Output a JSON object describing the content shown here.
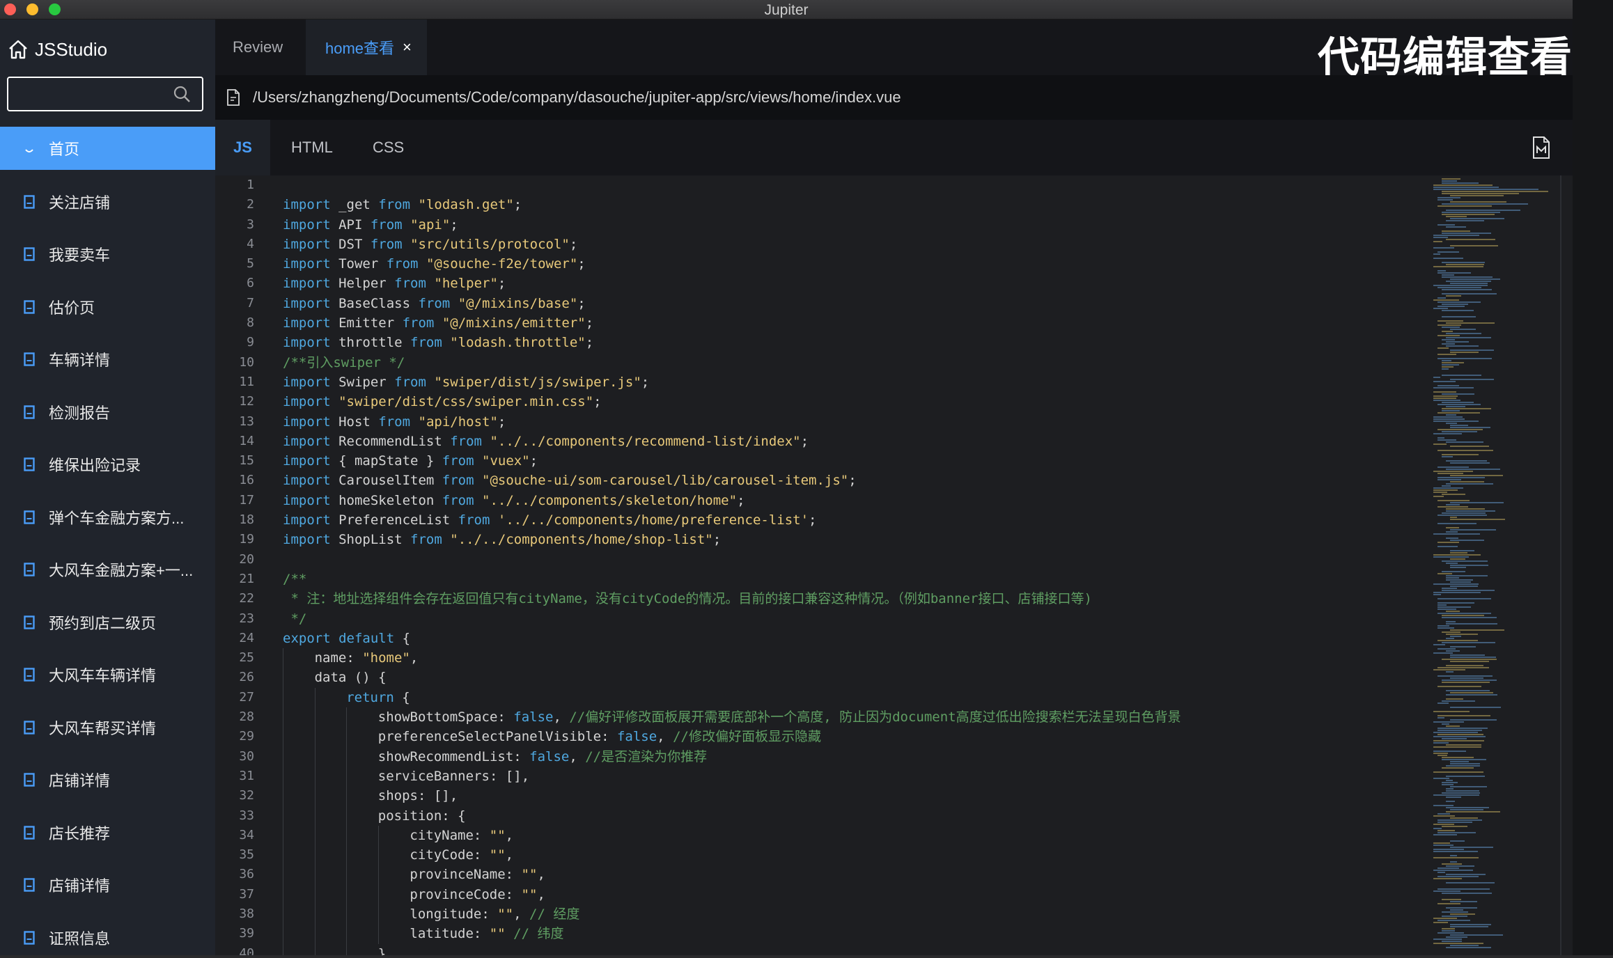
{
  "window": {
    "title": "Jupiter"
  },
  "overlay": {
    "caption": "代码编辑查看"
  },
  "sidebar": {
    "brand": "JSStudio",
    "search": {
      "value": "",
      "placeholder": ""
    },
    "items": [
      {
        "label": "首页",
        "active": true
      },
      {
        "label": "关注店铺"
      },
      {
        "label": "我要卖车"
      },
      {
        "label": "估价页"
      },
      {
        "label": "车辆详情"
      },
      {
        "label": "检测报告"
      },
      {
        "label": "维保出险记录"
      },
      {
        "label": "弹个车金融方案方..."
      },
      {
        "label": "大风车金融方案+一..."
      },
      {
        "label": "预约到店二级页"
      },
      {
        "label": "大风车车辆详情"
      },
      {
        "label": "大风车帮买详情"
      },
      {
        "label": "店铺详情"
      },
      {
        "label": "店长推荐"
      },
      {
        "label": "店铺详情"
      },
      {
        "label": "证照信息"
      }
    ]
  },
  "tabs": [
    {
      "label": "Review"
    },
    {
      "label": "home查看",
      "active": true,
      "close": "×"
    }
  ],
  "file": {
    "path": "/Users/zhangzheng/Documents/Code/company/dasouche/jupiter-app/src/views/home/index.vue"
  },
  "code_tabs": [
    {
      "label": "JS",
      "active": true
    },
    {
      "label": "HTML"
    },
    {
      "label": "CSS"
    }
  ],
  "colors": {
    "accent": "#4a9df8",
    "sidebar_bg": "#20242c",
    "editor_bg": "#1d1e21",
    "keyword": "#4fa8e0",
    "string": "#e8c97a",
    "comment": "#5f9e62"
  },
  "code": {
    "lines": [
      {
        "n": "1",
        "indent": 0,
        "tokens": []
      },
      {
        "n": "2",
        "indent": 0,
        "tokens": [
          [
            "kw",
            "import"
          ],
          [
            "id",
            " _get "
          ],
          [
            "kw",
            "from"
          ],
          [
            "id",
            " "
          ],
          [
            "str",
            "\"lodash.get\""
          ],
          [
            "id",
            ";"
          ]
        ]
      },
      {
        "n": "3",
        "indent": 0,
        "tokens": [
          [
            "kw",
            "import"
          ],
          [
            "id",
            " API "
          ],
          [
            "kw",
            "from"
          ],
          [
            "id",
            " "
          ],
          [
            "str",
            "\"api\""
          ],
          [
            "id",
            ";"
          ]
        ]
      },
      {
        "n": "4",
        "indent": 0,
        "tokens": [
          [
            "kw",
            "import"
          ],
          [
            "id",
            " DST "
          ],
          [
            "kw",
            "from"
          ],
          [
            "id",
            " "
          ],
          [
            "str",
            "\"src/utils/protocol\""
          ],
          [
            "id",
            ";"
          ]
        ]
      },
      {
        "n": "5",
        "indent": 0,
        "tokens": [
          [
            "kw",
            "import"
          ],
          [
            "id",
            " Tower "
          ],
          [
            "kw",
            "from"
          ],
          [
            "id",
            " "
          ],
          [
            "str",
            "\"@souche-f2e/tower\""
          ],
          [
            "id",
            ";"
          ]
        ]
      },
      {
        "n": "6",
        "indent": 0,
        "tokens": [
          [
            "kw",
            "import"
          ],
          [
            "id",
            " Helper "
          ],
          [
            "kw",
            "from"
          ],
          [
            "id",
            " "
          ],
          [
            "str",
            "\"helper\""
          ],
          [
            "id",
            ";"
          ]
        ]
      },
      {
        "n": "7",
        "indent": 0,
        "tokens": [
          [
            "kw",
            "import"
          ],
          [
            "id",
            " BaseClass "
          ],
          [
            "kw",
            "from"
          ],
          [
            "id",
            " "
          ],
          [
            "str",
            "\"@/mixins/base\""
          ],
          [
            "id",
            ";"
          ]
        ]
      },
      {
        "n": "8",
        "indent": 0,
        "tokens": [
          [
            "kw",
            "import"
          ],
          [
            "id",
            " Emitter "
          ],
          [
            "kw",
            "from"
          ],
          [
            "id",
            " "
          ],
          [
            "str",
            "\"@/mixins/emitter\""
          ],
          [
            "id",
            ";"
          ]
        ]
      },
      {
        "n": "9",
        "indent": 0,
        "tokens": [
          [
            "kw",
            "import"
          ],
          [
            "id",
            " throttle "
          ],
          [
            "kw",
            "from"
          ],
          [
            "id",
            " "
          ],
          [
            "str",
            "\"lodash.throttle\""
          ],
          [
            "id",
            ";"
          ]
        ]
      },
      {
        "n": "10",
        "indent": 0,
        "tokens": [
          [
            "cm",
            "/**引入swiper */"
          ]
        ]
      },
      {
        "n": "11",
        "indent": 0,
        "tokens": [
          [
            "kw",
            "import"
          ],
          [
            "id",
            " Swiper "
          ],
          [
            "kw",
            "from"
          ],
          [
            "id",
            " "
          ],
          [
            "str",
            "\"swiper/dist/js/swiper.js\""
          ],
          [
            "id",
            ";"
          ]
        ]
      },
      {
        "n": "12",
        "indent": 0,
        "tokens": [
          [
            "kw",
            "import"
          ],
          [
            "id",
            " "
          ],
          [
            "str",
            "\"swiper/dist/css/swiper.min.css\""
          ],
          [
            "id",
            ";"
          ]
        ]
      },
      {
        "n": "13",
        "indent": 0,
        "tokens": [
          [
            "kw",
            "import"
          ],
          [
            "id",
            " Host "
          ],
          [
            "kw",
            "from"
          ],
          [
            "id",
            " "
          ],
          [
            "str",
            "\"api/host\""
          ],
          [
            "id",
            ";"
          ]
        ]
      },
      {
        "n": "14",
        "indent": 0,
        "tokens": [
          [
            "kw",
            "import"
          ],
          [
            "id",
            " RecommendList "
          ],
          [
            "kw",
            "from"
          ],
          [
            "id",
            " "
          ],
          [
            "str",
            "\"../../components/recommend-list/index\""
          ],
          [
            "id",
            ";"
          ]
        ]
      },
      {
        "n": "15",
        "indent": 0,
        "tokens": [
          [
            "kw",
            "import"
          ],
          [
            "id",
            " { mapState } "
          ],
          [
            "kw",
            "from"
          ],
          [
            "id",
            " "
          ],
          [
            "str",
            "\"vuex\""
          ],
          [
            "id",
            ";"
          ]
        ]
      },
      {
        "n": "16",
        "indent": 0,
        "tokens": [
          [
            "kw",
            "import"
          ],
          [
            "id",
            " CarouselItem "
          ],
          [
            "kw",
            "from"
          ],
          [
            "id",
            " "
          ],
          [
            "str",
            "\"@souche-ui/som-carousel/lib/carousel-item.js\""
          ],
          [
            "id",
            ";"
          ]
        ]
      },
      {
        "n": "17",
        "indent": 0,
        "tokens": [
          [
            "kw",
            "import"
          ],
          [
            "id",
            " homeSkeleton "
          ],
          [
            "kw",
            "from"
          ],
          [
            "id",
            " "
          ],
          [
            "str",
            "\"../../components/skeleton/home\""
          ],
          [
            "id",
            ";"
          ]
        ]
      },
      {
        "n": "18",
        "indent": 0,
        "tokens": [
          [
            "kw",
            "import"
          ],
          [
            "id",
            " PreferenceList "
          ],
          [
            "kw",
            "from"
          ],
          [
            "id",
            " "
          ],
          [
            "str",
            "'../../components/home/preference-list'"
          ],
          [
            "id",
            ";"
          ]
        ]
      },
      {
        "n": "19",
        "indent": 0,
        "tokens": [
          [
            "kw",
            "import"
          ],
          [
            "id",
            " ShopList "
          ],
          [
            "kw",
            "from"
          ],
          [
            "id",
            " "
          ],
          [
            "str",
            "\"../../components/home/shop-list\""
          ],
          [
            "id",
            ";"
          ]
        ]
      },
      {
        "n": "20",
        "indent": 0,
        "tokens": []
      },
      {
        "n": "21",
        "indent": 0,
        "tokens": [
          [
            "cm",
            "/**"
          ]
        ]
      },
      {
        "n": "22",
        "indent": 0,
        "tokens": [
          [
            "cm",
            " * 注：地址选择组件会存在返回值只有cityName，没有cityCode的情况。目前的接口兼容这种情况。（例如banner接口、店铺接口等)"
          ]
        ]
      },
      {
        "n": "23",
        "indent": 0,
        "tokens": [
          [
            "cm",
            " */"
          ]
        ]
      },
      {
        "n": "24",
        "indent": 0,
        "tokens": [
          [
            "kw",
            "export default"
          ],
          [
            "id",
            " {"
          ]
        ]
      },
      {
        "n": "25",
        "indent": 1,
        "tokens": [
          [
            "id",
            "name: "
          ],
          [
            "str",
            "\"home\""
          ],
          [
            "id",
            ","
          ]
        ]
      },
      {
        "n": "26",
        "indent": 1,
        "tokens": [
          [
            "id",
            "data () {"
          ]
        ]
      },
      {
        "n": "27",
        "indent": 2,
        "tokens": [
          [
            "kw",
            "return"
          ],
          [
            "id",
            " {"
          ]
        ]
      },
      {
        "n": "28",
        "indent": 3,
        "tokens": [
          [
            "id",
            "showBottomSpace: "
          ],
          [
            "kw",
            "false"
          ],
          [
            "id",
            ", "
          ],
          [
            "cm",
            "//偏好评修改面板展开需要底部补一个高度, 防止因为document高度过低出险搜索栏无法呈现白色背景"
          ]
        ]
      },
      {
        "n": "29",
        "indent": 3,
        "tokens": [
          [
            "id",
            "preferenceSelectPanelVisible: "
          ],
          [
            "kw",
            "false"
          ],
          [
            "id",
            ", "
          ],
          [
            "cm",
            "//修改偏好面板显示隐藏"
          ]
        ]
      },
      {
        "n": "30",
        "indent": 3,
        "tokens": [
          [
            "id",
            "showRecommendList: "
          ],
          [
            "kw",
            "false"
          ],
          [
            "id",
            ", "
          ],
          [
            "cm",
            "//是否渲染为你推荐"
          ]
        ]
      },
      {
        "n": "31",
        "indent": 3,
        "tokens": [
          [
            "id",
            "serviceBanners: [],"
          ]
        ]
      },
      {
        "n": "32",
        "indent": 3,
        "tokens": [
          [
            "id",
            "shops: [],"
          ]
        ]
      },
      {
        "n": "33",
        "indent": 3,
        "tokens": [
          [
            "id",
            "position: {"
          ]
        ]
      },
      {
        "n": "34",
        "indent": 4,
        "tokens": [
          [
            "id",
            "cityName: "
          ],
          [
            "str",
            "\"\""
          ],
          [
            "id",
            ","
          ]
        ]
      },
      {
        "n": "35",
        "indent": 4,
        "tokens": [
          [
            "id",
            "cityCode: "
          ],
          [
            "str",
            "\"\""
          ],
          [
            "id",
            ","
          ]
        ]
      },
      {
        "n": "36",
        "indent": 4,
        "tokens": [
          [
            "id",
            "provinceName: "
          ],
          [
            "str",
            "\"\""
          ],
          [
            "id",
            ","
          ]
        ]
      },
      {
        "n": "37",
        "indent": 4,
        "tokens": [
          [
            "id",
            "provinceCode: "
          ],
          [
            "str",
            "\"\""
          ],
          [
            "id",
            ","
          ]
        ]
      },
      {
        "n": "38",
        "indent": 4,
        "tokens": [
          [
            "id",
            "longitude: "
          ],
          [
            "str",
            "\"\""
          ],
          [
            "id",
            ", "
          ],
          [
            "cm",
            "// 经度"
          ]
        ]
      },
      {
        "n": "39",
        "indent": 4,
        "tokens": [
          [
            "id",
            "latitude: "
          ],
          [
            "str",
            "\"\""
          ],
          [
            "id",
            " "
          ],
          [
            "cm",
            "// 纬度"
          ]
        ]
      },
      {
        "n": "40",
        "indent": 3,
        "tokens": [
          [
            "id",
            "},"
          ]
        ]
      }
    ]
  }
}
